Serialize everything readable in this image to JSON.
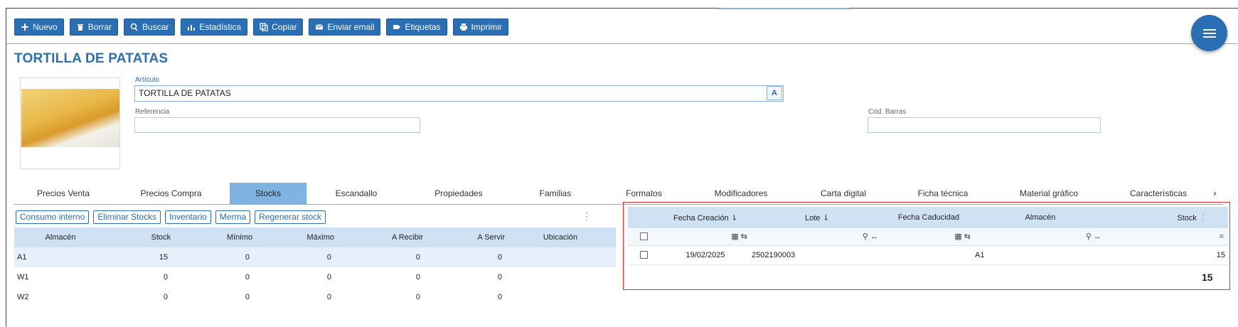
{
  "toolbar": {
    "nuevo": "Nuevo",
    "borrar": "Borrar",
    "buscar": "Buscar",
    "estadistica": "Estadística",
    "copiar": "Copiar",
    "enviar": "Enviar email",
    "etiquetas": "Etiquetas",
    "imprimir": "Imprimir"
  },
  "title": "TORTILLA DE PATATAS",
  "form": {
    "articulo_label": "Artículo",
    "articulo_value": "TORTILLA DE PATATAS",
    "referencia_label": "Referencia",
    "referencia_value": "",
    "codbarras_label": "Cód. Barras",
    "codbarras_value": ""
  },
  "tabs": [
    "Precios Venta",
    "Precios Compra",
    "Stocks",
    "Escandallo",
    "Propiedades",
    "Familias",
    "Formatos",
    "Modificadores",
    "Carta digital",
    "Ficha técnica",
    "Material gráfico",
    "Características"
  ],
  "active_tab": "Stocks",
  "left_buttons": {
    "consumo": "Consumo interno",
    "eliminar": "Eliminar Stocks",
    "inventario": "Inventario",
    "merma": "Merma",
    "regenerar": "Regenerar stock"
  },
  "stock_table": {
    "headers": [
      "Almacén",
      "Stock",
      "Mínimo",
      "Máximo",
      "A Recibir",
      "A Servir",
      "Ubicación"
    ],
    "rows": [
      [
        "A1",
        "15",
        "0",
        "0",
        "0",
        "0",
        ""
      ],
      [
        "W1",
        "0",
        "0",
        "0",
        "0",
        "0",
        ""
      ],
      [
        "W2",
        "0",
        "0",
        "0",
        "0",
        "0",
        ""
      ]
    ]
  },
  "lot_table": {
    "headers": [
      "Fecha Creación",
      "Lote",
      "Fecha Caducidad",
      "Almacén",
      "Stock"
    ],
    "filter_stock": "=",
    "rows": [
      [
        "19/02/2025",
        "2502190003",
        "",
        "A1",
        "15"
      ]
    ],
    "total": "15"
  },
  "colors": {
    "accent": "#2a6eb3",
    "header_bg": "#cfe2f3",
    "highlight": "#dd3333"
  }
}
